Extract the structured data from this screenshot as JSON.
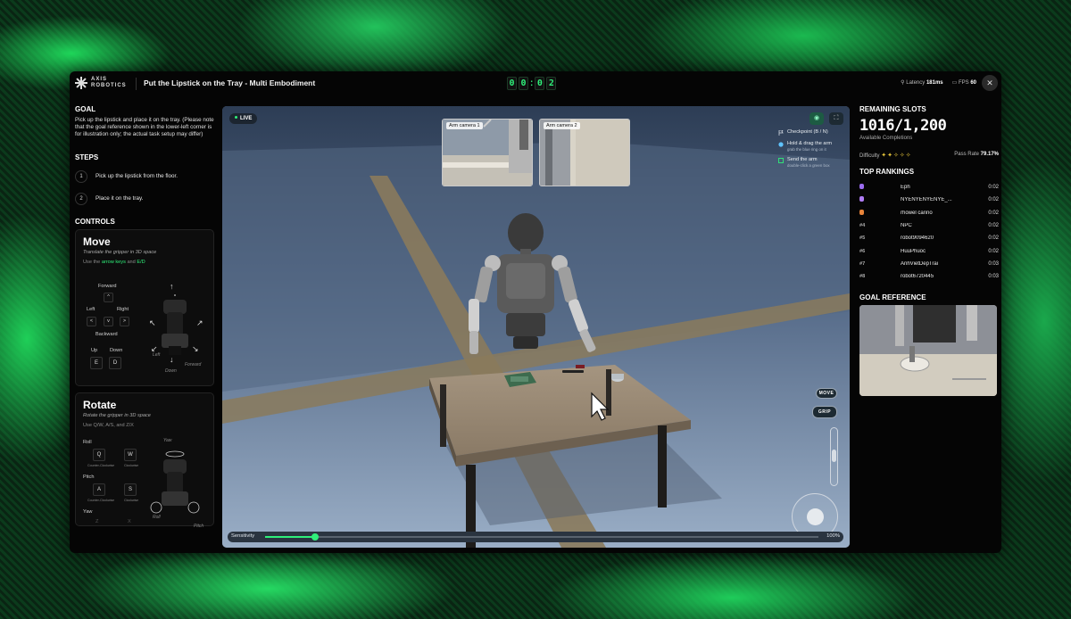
{
  "header": {
    "logo_line1": "AXIS",
    "logo_line2": "ROBOTICS",
    "task_title": "Put the Lipstick on the Tray - Multi Embodiment",
    "timer": [
      "0",
      "0",
      "0",
      "2"
    ],
    "latency_label": "Latency",
    "latency_value": "181ms",
    "fps_label": "FPS",
    "fps_value": "60",
    "close_label": "✕"
  },
  "left": {
    "goal_title": "GOAL",
    "goal_text": "Pick up the lipstick and place it on the tray. (Please note that the goal reference shown in the lower-left corner is for illustration only; the actual task setup may differ)",
    "steps_title": "STEPS",
    "steps": [
      {
        "num": "1",
        "text": "Pick up the lipstick from the floor."
      },
      {
        "num": "2",
        "text": "Place it on the tray."
      }
    ],
    "controls_title": "CONTROLS",
    "move": {
      "title": "Move",
      "subtitle": "Translate the gripper in 3D space",
      "hint_pre": "Use the ",
      "hint_keys": "arrow keys",
      "hint_mid": " and ",
      "hint_keys2": "E/D",
      "forward": "Forward",
      "left": "Left",
      "right": "Right",
      "backward": "Backward",
      "up": "Up",
      "down": "Down",
      "key_up": "^",
      "key_left": "<",
      "key_down": "v",
      "key_right": ">",
      "key_e": "E",
      "key_d": "D",
      "dir_left": "Left",
      "dir_down": "Down",
      "dir_forward": "Forward"
    },
    "rotate": {
      "title": "Rotate",
      "subtitle": "Rotate the gripper in 3D space",
      "hint_pre": "Use ",
      "hint_keys": "Q/W, A/S, and Z/X",
      "roll": "Roll",
      "pitch": "Pitch",
      "yaw": "Yaw",
      "key_q": "Q",
      "key_w": "W",
      "key_a": "A",
      "key_s": "S",
      "key_z": "Z",
      "key_x": "X",
      "counter": "Counter-Clockwise",
      "clockwise": "Clockwise",
      "dir_yaw": "Yaw",
      "dir_roll": "Roll",
      "dir_pitch": "Pitch"
    }
  },
  "viewport": {
    "live_label": "LIVE",
    "cam1_label": "Arm camera 1",
    "cam2_label": "Arm camera 2",
    "checklist": [
      {
        "title": "Checkpoint (B / N)",
        "sub": ""
      },
      {
        "title": "Hold & drag the arm",
        "sub": "grab the blue ring on it"
      },
      {
        "title": "Send the arm",
        "sub": "double-click a green box"
      }
    ],
    "move_btn": "MOVE",
    "grip_btn": "GRIP",
    "sensitivity_label": "Sensitivity",
    "sensitivity_value": "100%",
    "sensitivity_level": 0.09
  },
  "right": {
    "slots_title": "REMAINING SLOTS",
    "slots_value": "1016/1,200",
    "slots_sub": "Available Completions",
    "difficulty_label": "Difficulty",
    "difficulty_stars": "✦✦✧✧✧",
    "pass_rate_label": "Pass Rate",
    "pass_rate_value": "79.17%",
    "rankings_title": "TOP RANKINGS",
    "rankings": [
      {
        "pos": "",
        "gem": "#9b6cf0",
        "name": "Eph",
        "time": "0:02"
      },
      {
        "pos": "",
        "gem": "#b07cf5",
        "name": "NYENYENYENYE_...",
        "time": "0:02"
      },
      {
        "pos": "",
        "gem": "#e8843a",
        "name": "rhowel cariño",
        "time": "0:02"
      },
      {
        "pos": "#4",
        "gem": "",
        "name": "NPC",
        "time": "0:02"
      },
      {
        "pos": "#5",
        "gem": "",
        "name": "robot9094620",
        "time": "0:02"
      },
      {
        "pos": "#6",
        "gem": "",
        "name": "HuuPhuoc",
        "time": "0:02"
      },
      {
        "pos": "#7",
        "gem": "",
        "name": "AnhVietDepTrai",
        "time": "0:03"
      },
      {
        "pos": "#8",
        "gem": "",
        "name": "robot6720445",
        "time": "0:03"
      }
    ],
    "goal_ref_title": "GOAL REFERENCE"
  },
  "colors": {
    "accent": "#2ff07a",
    "window_bg": "#050505",
    "star": "#e6c53b"
  }
}
